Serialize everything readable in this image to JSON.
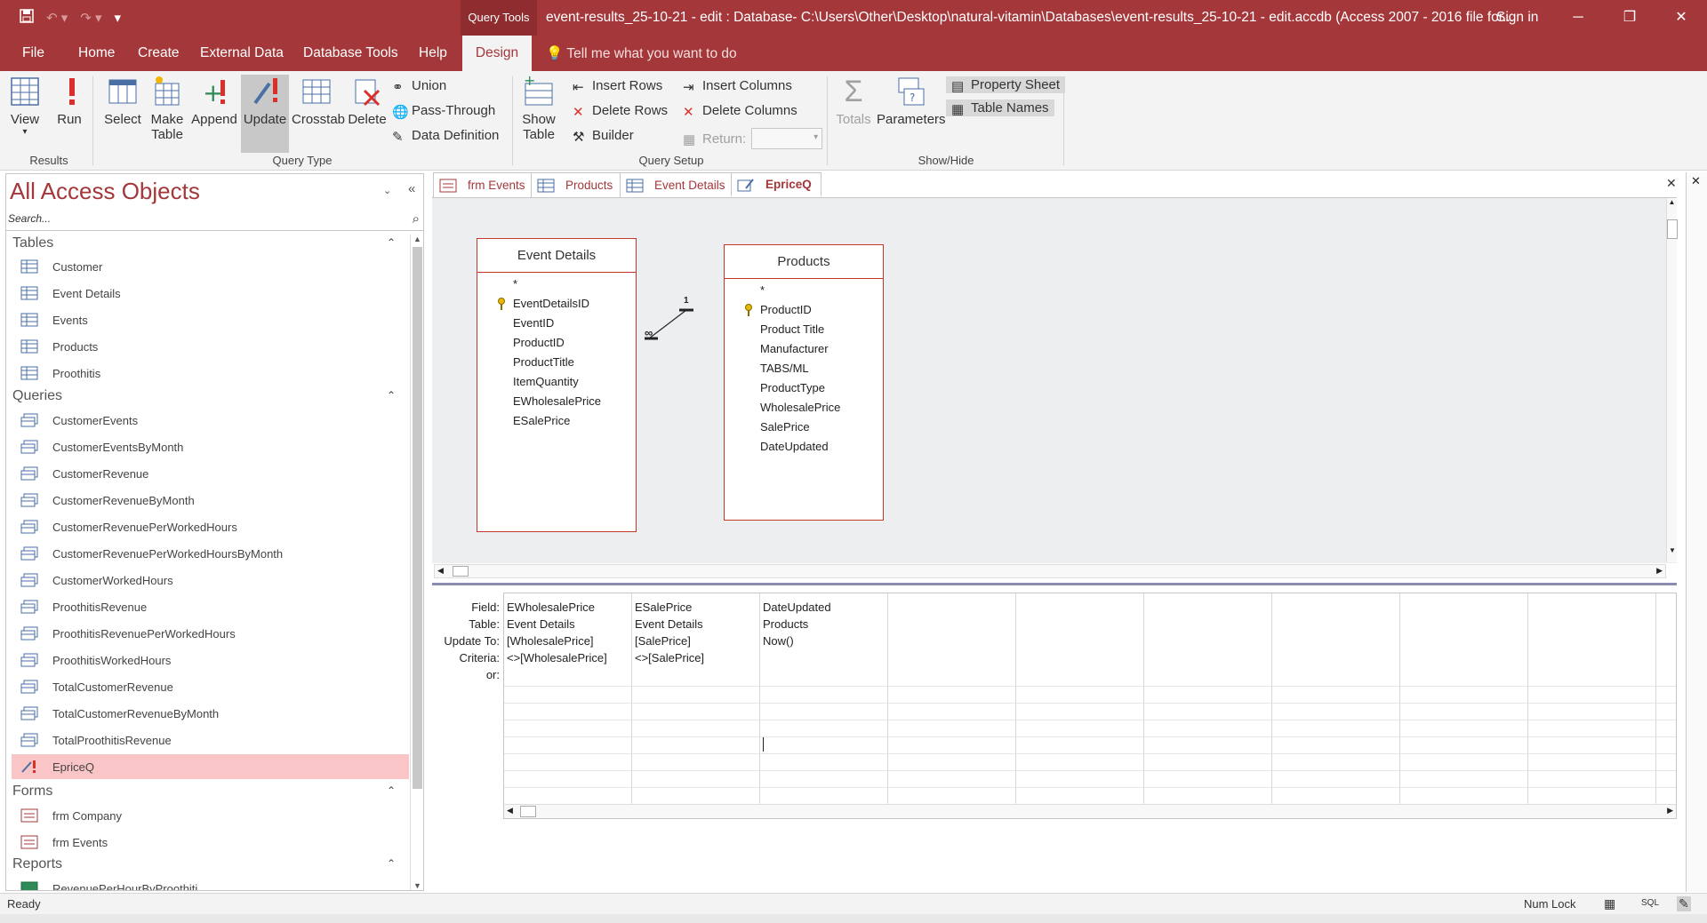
{
  "titlebar": {
    "context_tools": "Query Tools",
    "doc_title": "event-results_25-10-21 - edit : Database- C:\\Users\\Other\\Desktop\\natural-vitamin\\Databases\\event-results_25-10-21 - edit.accdb (Access 2007 - 2016 file for...",
    "signin": "Sign in"
  },
  "menu": {
    "file": "File",
    "home": "Home",
    "create": "Create",
    "external": "External Data",
    "dbtools": "Database Tools",
    "help": "Help",
    "design": "Design",
    "tellme": "Tell me what you want to do"
  },
  "ribbon": {
    "results": {
      "label": "Results",
      "view": "View",
      "run": "Run"
    },
    "query_type": {
      "label": "Query Type",
      "select": "Select",
      "make_table_1": "Make",
      "make_table_2": "Table",
      "append": "Append",
      "update": "Update",
      "crosstab": "Crosstab",
      "delete": "Delete",
      "union": "Union",
      "pass_through": "Pass-Through",
      "data_definition": "Data Definition"
    },
    "query_setup": {
      "label": "Query Setup",
      "show_table_1": "Show",
      "show_table_2": "Table",
      "insert_rows": "Insert Rows",
      "delete_rows": "Delete Rows",
      "builder": "Builder",
      "insert_columns": "Insert Columns",
      "delete_columns": "Delete Columns",
      "return": "Return:"
    },
    "show_hide": {
      "label": "Show/Hide",
      "totals": "Totals",
      "parameters": "Parameters",
      "property_sheet": "Property Sheet",
      "table_names": "Table Names"
    }
  },
  "nav": {
    "title": "All Access Objects",
    "search_placeholder": "Search...",
    "tables_label": "Tables",
    "tables": [
      "Customer",
      "Event Details",
      "Events",
      "Products",
      "Proothitis"
    ],
    "queries_label": "Queries",
    "queries": [
      "CustomerEvents",
      "CustomerEventsByMonth",
      "CustomerRevenue",
      "CustomerRevenueByMonth",
      "CustomerRevenuePerWorkedHours",
      "CustomerRevenuePerWorkedHoursByMonth",
      "CustomerWorkedHours",
      "ProothitisRevenue",
      "ProothitisRevenuePerWorkedHours",
      "ProothitisWorkedHours",
      "TotalCustomerRevenue",
      "TotalCustomerRevenueByMonth",
      "TotalProothitisRevenue",
      "EpriceQ"
    ],
    "forms_label": "Forms",
    "forms": [
      "frm Company",
      "frm Events"
    ],
    "reports_label": "Reports",
    "reports": [
      "RevenuePerHourByProothiti"
    ]
  },
  "doctabs": [
    "frm Events",
    "Products",
    "Event Details",
    "EpriceQ"
  ],
  "design": {
    "event_details": {
      "title": "Event Details",
      "fields": [
        "*",
        "EventDetailsID",
        "EventID",
        "ProductID",
        "ProductTitle",
        "ItemQuantity",
        "EWholesalePrice",
        "ESalePrice"
      ]
    },
    "products": {
      "title": "Products",
      "fields": [
        "*",
        "ProductID",
        "Product Title",
        "Manufacturer",
        "TABS/ML",
        "ProductType",
        "WholesalePrice",
        "SalePrice",
        "DateUpdated"
      ]
    },
    "join_one": "1",
    "join_many": "∞"
  },
  "grid": {
    "row_labels": [
      "Field:",
      "Table:",
      "Update To:",
      "Criteria:",
      "or:"
    ],
    "columns": [
      {
        "field": "EWholesalePrice",
        "table": "Event Details",
        "update": "[WholesalePrice]",
        "criteria": "<>[WholesalePrice]"
      },
      {
        "field": "ESalePrice",
        "table": "Event Details",
        "update": "[SalePrice]",
        "criteria": "<>[SalePrice]"
      },
      {
        "field": "DateUpdated",
        "table": "Products",
        "update": "Now()",
        "criteria": ""
      }
    ]
  },
  "status": {
    "ready": "Ready",
    "numlock": "Num Lock",
    "sql": "SQL"
  },
  "colors": {
    "accent": "#a4373a",
    "selected_nav": "#f9c5c6"
  }
}
